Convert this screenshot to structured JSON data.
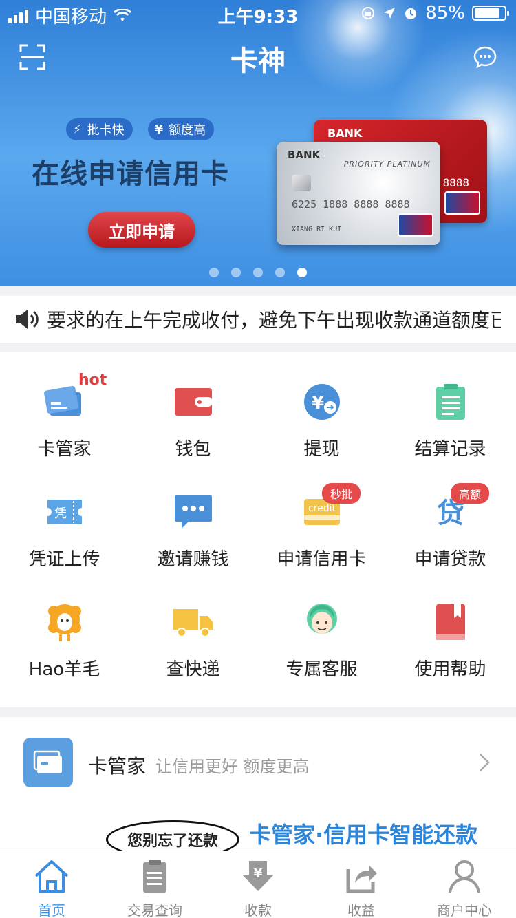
{
  "status_bar": {
    "carrier": "中国移动",
    "time": "上午9:33",
    "battery_percent": "85%",
    "battery_level": 0.85
  },
  "header": {
    "title": "卡神",
    "scan_icon": "scan-icon",
    "message_icon": "chat-bubble-icon"
  },
  "banner": {
    "tags": [
      {
        "icon": "⚡",
        "label": "批卡快"
      },
      {
        "icon": "¥",
        "label": "额度高"
      }
    ],
    "headline": "在线申请信用卡",
    "cta_label": "立即申请",
    "card_red": {
      "bank": "BANK",
      "number": "8888"
    },
    "card_silver": {
      "bank": "BANK",
      "tier": "PRIORITY PLATINUM",
      "number": "6225 1888 8888 8888",
      "holder": "XIANG RI KUI"
    },
    "slide_count": 5,
    "active_slide": 5
  },
  "notice": {
    "text": "要求的在上午完成收付，避免下午出现收款通道额度已"
  },
  "grid": {
    "items": [
      {
        "label": "卡管家",
        "icon": "credit-card-icon",
        "badge": "hot",
        "color": "#4a90d9"
      },
      {
        "label": "钱包",
        "icon": "wallet-icon",
        "color": "#e05050"
      },
      {
        "label": "提现",
        "icon": "withdraw-icon",
        "color": "#4a90d9"
      },
      {
        "label": "结算记录",
        "icon": "clipboard-icon",
        "color": "#5fcfa6"
      },
      {
        "label": "凭证上传",
        "icon": "voucher-icon",
        "text": "凭",
        "color": "#5ba4e6"
      },
      {
        "label": "邀请赚钱",
        "icon": "chat-dots-icon",
        "color": "#4a90d9"
      },
      {
        "label": "申请信用卡",
        "icon": "credit-icon",
        "badge": "秒批",
        "text": "credit",
        "color": "#f2c24a"
      },
      {
        "label": "申请贷款",
        "icon": "loan-icon",
        "badge": "高额",
        "text": "贷",
        "color": "#4a90d9"
      },
      {
        "label": "Hao羊毛",
        "icon": "sheep-icon",
        "color": "#f5a623"
      },
      {
        "label": "查快递",
        "icon": "truck-icon",
        "color": "#f5c242"
      },
      {
        "label": "专属客服",
        "icon": "customer-service-icon",
        "color": "#5fcfa6"
      },
      {
        "label": "使用帮助",
        "icon": "help-book-icon",
        "color": "#e05050"
      }
    ]
  },
  "promo": {
    "title": "卡管家",
    "subtitle": "让信用更好 额度更高",
    "bubble": "您别忘了还款",
    "slogan": "卡管家·信用卡智能还款"
  },
  "tabbar": {
    "tabs": [
      {
        "label": "首页",
        "icon": "home-icon",
        "active": true
      },
      {
        "label": "交易查询",
        "icon": "document-icon"
      },
      {
        "label": "收款",
        "icon": "receive-money-icon"
      },
      {
        "label": "收益",
        "icon": "share-icon"
      },
      {
        "label": "商户中心",
        "icon": "user-icon"
      }
    ]
  }
}
